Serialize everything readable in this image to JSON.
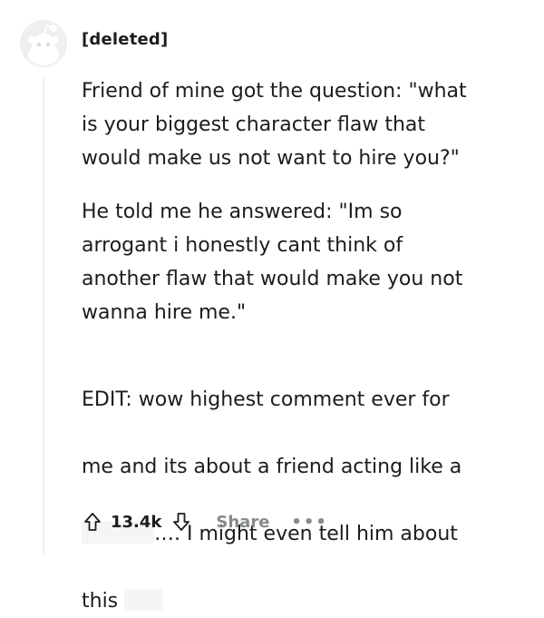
{
  "comment": {
    "username": "[deleted]",
    "paragraphs": [
      "Friend of mine got the question: \"what\nis your biggest character flaw that\nwould make us not want to hire you?\"",
      "He told me he answered: \"Im so\narrogant i honestly cant think of\nanother flaw that would make you not\nwanna hire me.\""
    ],
    "edit": {
      "line1": "EDIT: wow highest comment ever for",
      "line2": "me and its about a friend acting like a",
      "line3_after": "…. I might even tell him about",
      "line4_before": "this"
    }
  },
  "actions": {
    "score": "13.4k",
    "share_label": "Share",
    "more_label": "•••"
  },
  "icons": {
    "avatar": "snoo-avatar-icon",
    "upvote": "upvote-arrow-icon",
    "downvote": "downvote-arrow-icon",
    "more": "more-options-icon"
  },
  "colors": {
    "text": "#1c1c1c",
    "muted": "#878a8c",
    "thread": "#edeff1"
  }
}
